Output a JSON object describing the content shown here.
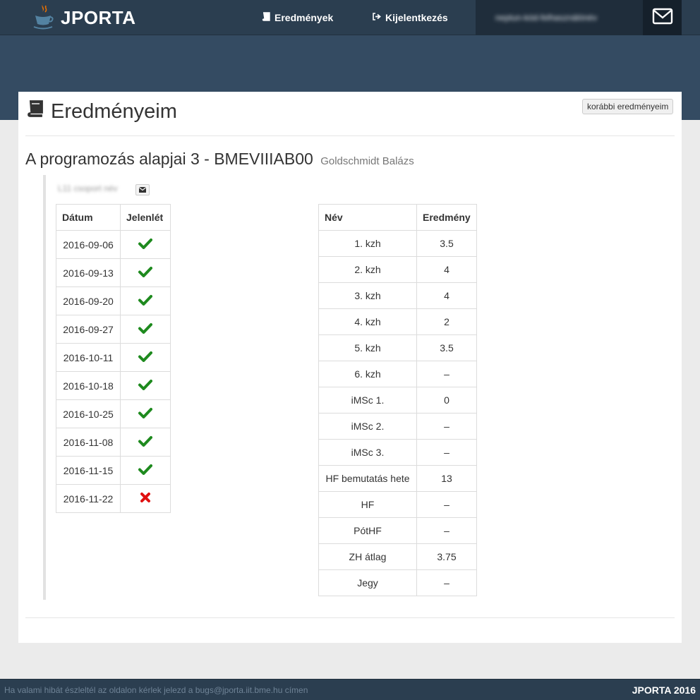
{
  "nav": {
    "brand": "JPORTA",
    "results_label": "Eredmények",
    "logout_label": "Kijelentkezés",
    "user_label": "neptun-kód-felhasználónév"
  },
  "page": {
    "title": "Eredményeim",
    "prev_button": "korábbi eredményeim"
  },
  "course": {
    "title": "A programozás alapjai 3 - BMEVIIIAB00",
    "lecturer": "Goldschmidt Balázs",
    "group_name": "L11 csoport név"
  },
  "attendance": {
    "headers": [
      "Dátum",
      "Jelenlét"
    ],
    "rows": [
      {
        "date": "2016-09-06",
        "present": true
      },
      {
        "date": "2016-09-13",
        "present": true
      },
      {
        "date": "2016-09-20",
        "present": true
      },
      {
        "date": "2016-09-27",
        "present": true
      },
      {
        "date": "2016-10-11",
        "present": true
      },
      {
        "date": "2016-10-18",
        "present": true
      },
      {
        "date": "2016-10-25",
        "present": true
      },
      {
        "date": "2016-11-08",
        "present": true
      },
      {
        "date": "2016-11-15",
        "present": true
      },
      {
        "date": "2016-11-22",
        "present": false
      }
    ]
  },
  "results": {
    "headers": [
      "Név",
      "Eredmény"
    ],
    "rows": [
      {
        "name": "1. kzh",
        "value": "3.5"
      },
      {
        "name": "2. kzh",
        "value": "4"
      },
      {
        "name": "3. kzh",
        "value": "4"
      },
      {
        "name": "4. kzh",
        "value": "2"
      },
      {
        "name": "5. kzh",
        "value": "3.5"
      },
      {
        "name": "6. kzh",
        "value": "–"
      },
      {
        "name": "iMSc 1.",
        "value": "0"
      },
      {
        "name": "iMSc 2.",
        "value": "–"
      },
      {
        "name": "iMSc 3.",
        "value": "–"
      },
      {
        "name": "HF bemutatás hete",
        "value": "13"
      },
      {
        "name": "HF",
        "value": "–"
      },
      {
        "name": "PótHF",
        "value": "–"
      },
      {
        "name": "ZH átlag",
        "value": "3.75"
      },
      {
        "name": "Jegy",
        "value": "–"
      }
    ]
  },
  "footer": {
    "notice": "Ha valami hibát észleltél az oldalon kérlek jelezd a bugs@jporta.iit.bme.hu címen",
    "copyright": "JPORTA 2016"
  },
  "icons": {
    "brand": "java-cup-icon",
    "results": "book-icon",
    "logout": "sign-out-icon",
    "mail": "envelope-icon",
    "present": "check-icon",
    "absent": "cross-icon"
  },
  "colors": {
    "navbar": "#2b3e50",
    "present": "#1e8a1e",
    "absent": "#e01010"
  }
}
